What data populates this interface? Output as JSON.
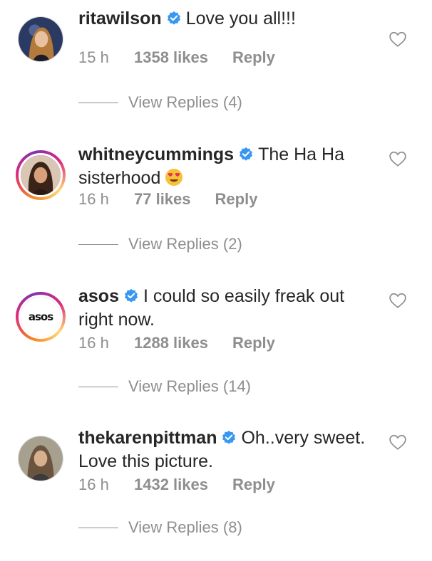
{
  "comments": [
    {
      "username": "ritawilson",
      "text": "Love you all!!!",
      "time": "15 h",
      "likes": "1358 likes",
      "reply": "Reply",
      "view_replies": "View Replies (4)",
      "avatar_icon": "profile-photo",
      "story_ring": false
    },
    {
      "username": "whitneycummings",
      "text": "The Ha Ha sisterhood",
      "emoji": "heart-eyes-emoji",
      "time": "16 h",
      "likes": "77 likes",
      "reply": "Reply",
      "view_replies": "View Replies (2)",
      "avatar_icon": "profile-photo",
      "story_ring": true
    },
    {
      "username": "asos",
      "text": "I could so easily freak out right now.",
      "time": "16 h",
      "likes": "1288 likes",
      "reply": "Reply",
      "view_replies": "View Replies (14)",
      "avatar_logo_text": "asos",
      "story_ring": true
    },
    {
      "username": "thekarenpittman",
      "text": "Oh..very sweet.  Love this picture.",
      "time": "16 h",
      "likes": "1432 likes",
      "reply": "Reply",
      "view_replies": "View Replies (8)",
      "avatar_icon": "profile-photo",
      "story_ring": false
    }
  ],
  "colors": {
    "text": "#262626",
    "secondary": "#8e8e8e",
    "verified": "#3897f0",
    "background": "#ffffff"
  },
  "icons": {
    "verified": "verified-badge-icon",
    "like": "heart-outline-icon"
  }
}
